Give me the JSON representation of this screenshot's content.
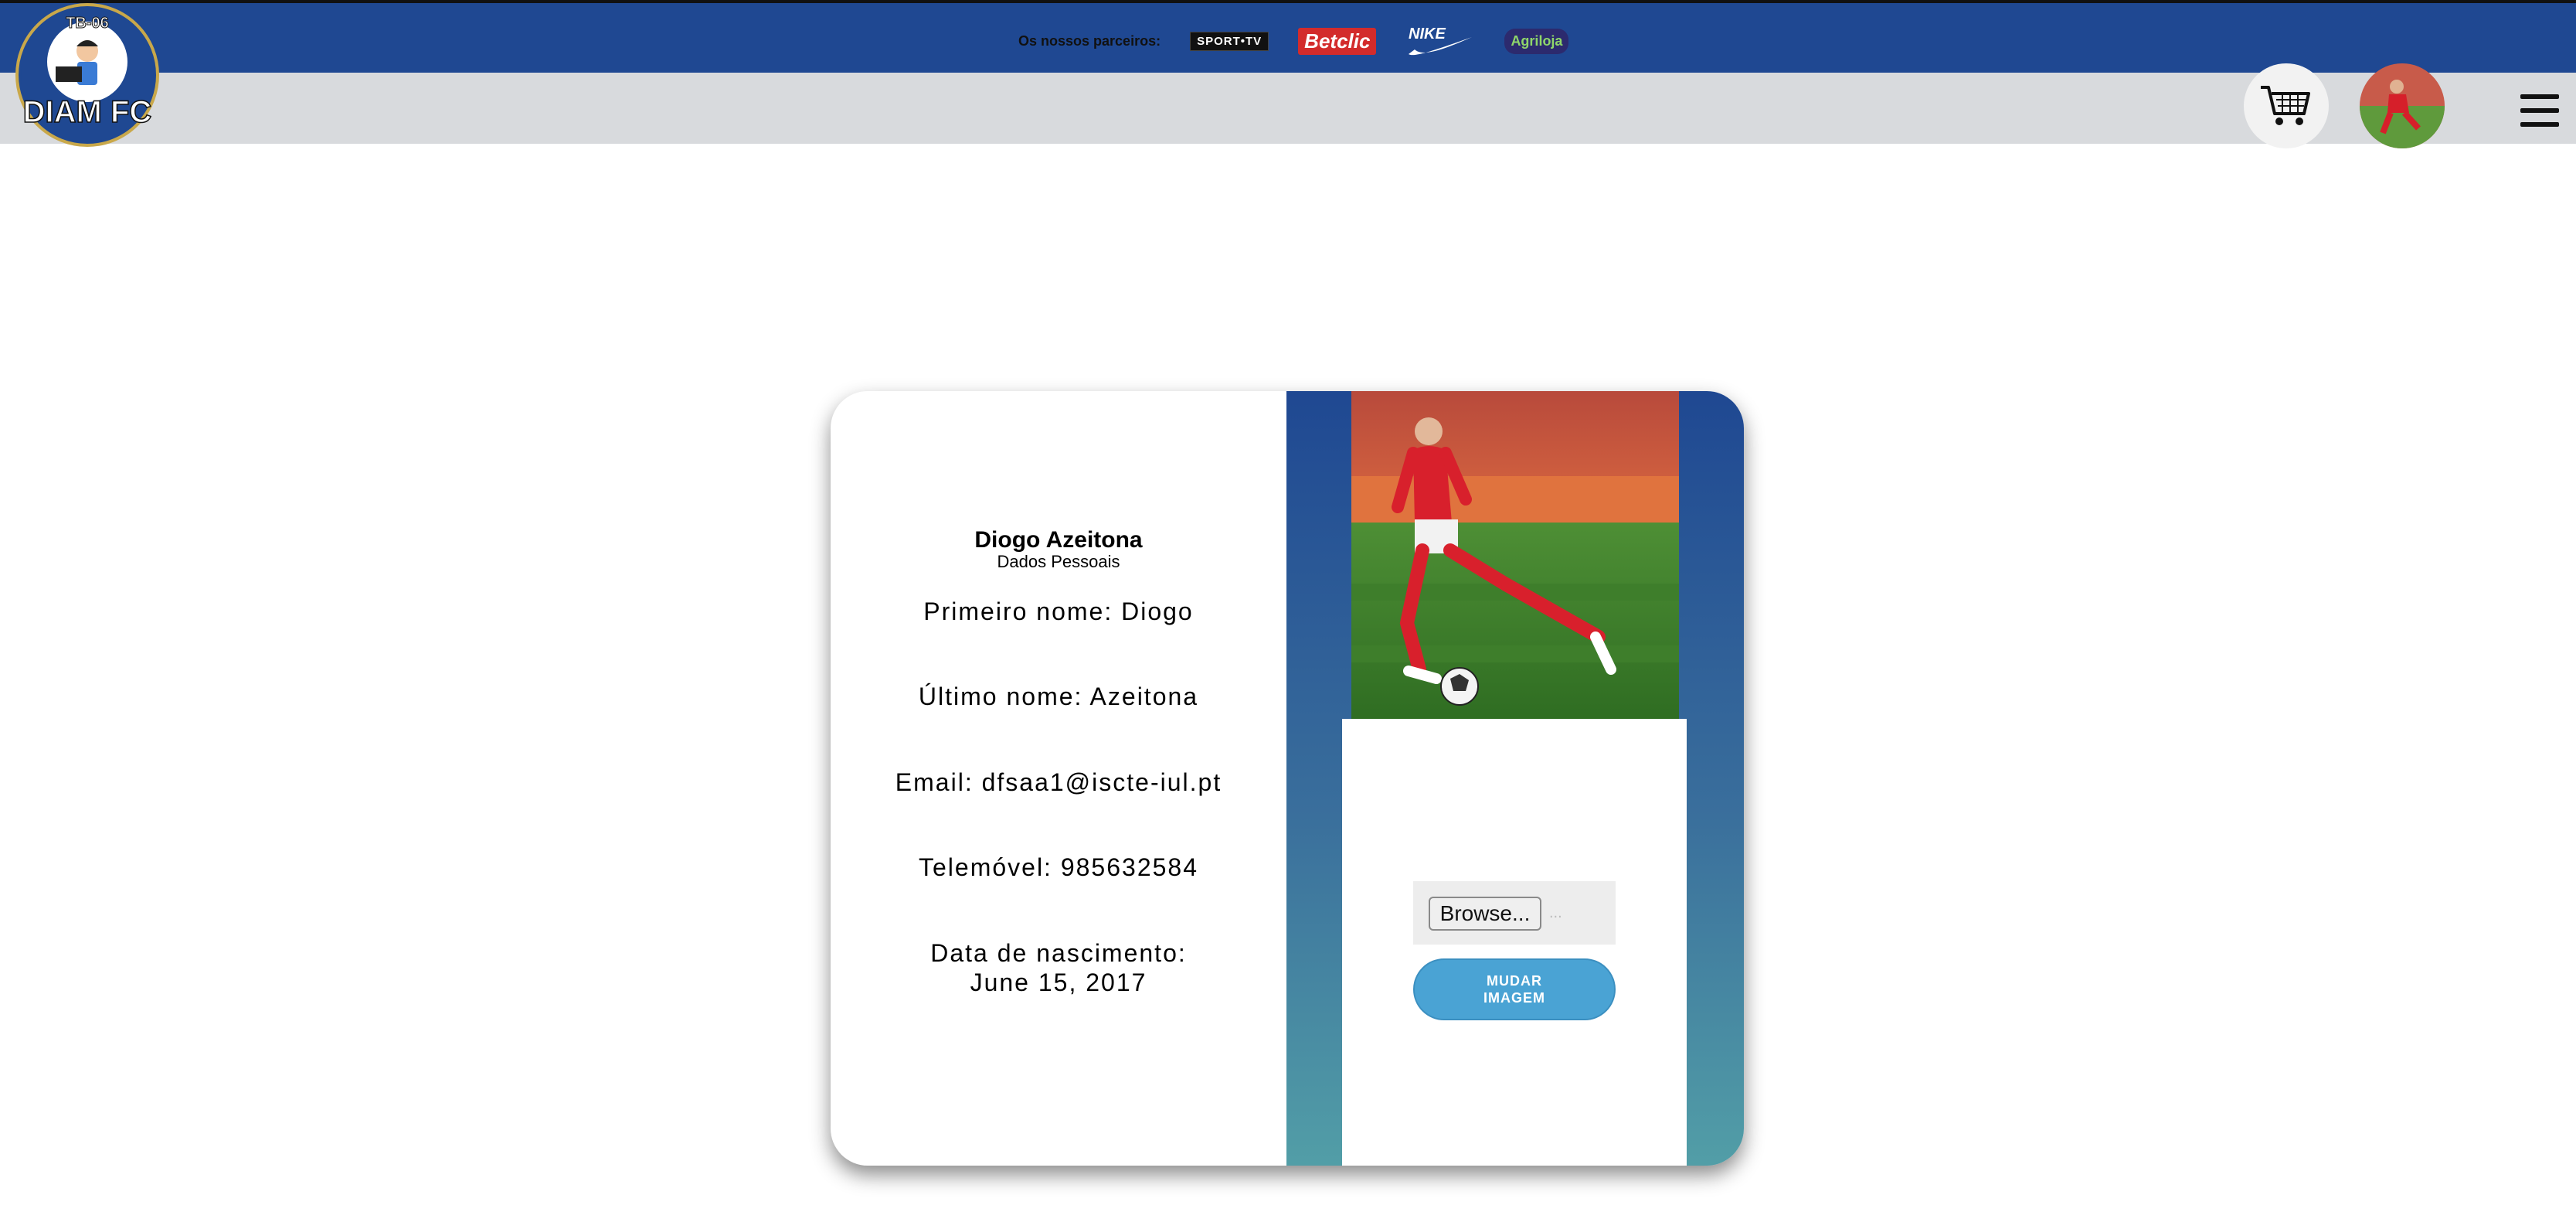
{
  "header": {
    "club_name": "DIAM FC",
    "club_tag": "TB-06",
    "partners_label": "Os nossos parceiros:",
    "partners": [
      "SPORT•TV",
      "Betclic",
      "NIKE",
      "Agriloja"
    ],
    "cart_icon": "shopping-cart-icon",
    "menu_icon": "hamburger-menu-icon",
    "colors": {
      "bar": "#1f4892",
      "subbar": "#d8dadd"
    }
  },
  "profile": {
    "name": "Diogo Azeitona",
    "subtitle": "Dados Pessoais",
    "first_name": "Primeiro nome: Diogo",
    "last_name": "Último nome: Azeitona",
    "email": "Email: dfsaa1@iscte-iul.pt",
    "phone": "Telemóvel: 985632584",
    "birth_label": "Data de nascimento:",
    "birth_date": "June 15, 2017"
  },
  "image_panel": {
    "browse_label": "Browse...",
    "file_status": "...",
    "change_button": "MUDAR IMAGEM",
    "colors": {
      "gradient_top": "#1f4892",
      "gradient_bottom": "#529ea7",
      "button": "#4aa3d4"
    }
  }
}
